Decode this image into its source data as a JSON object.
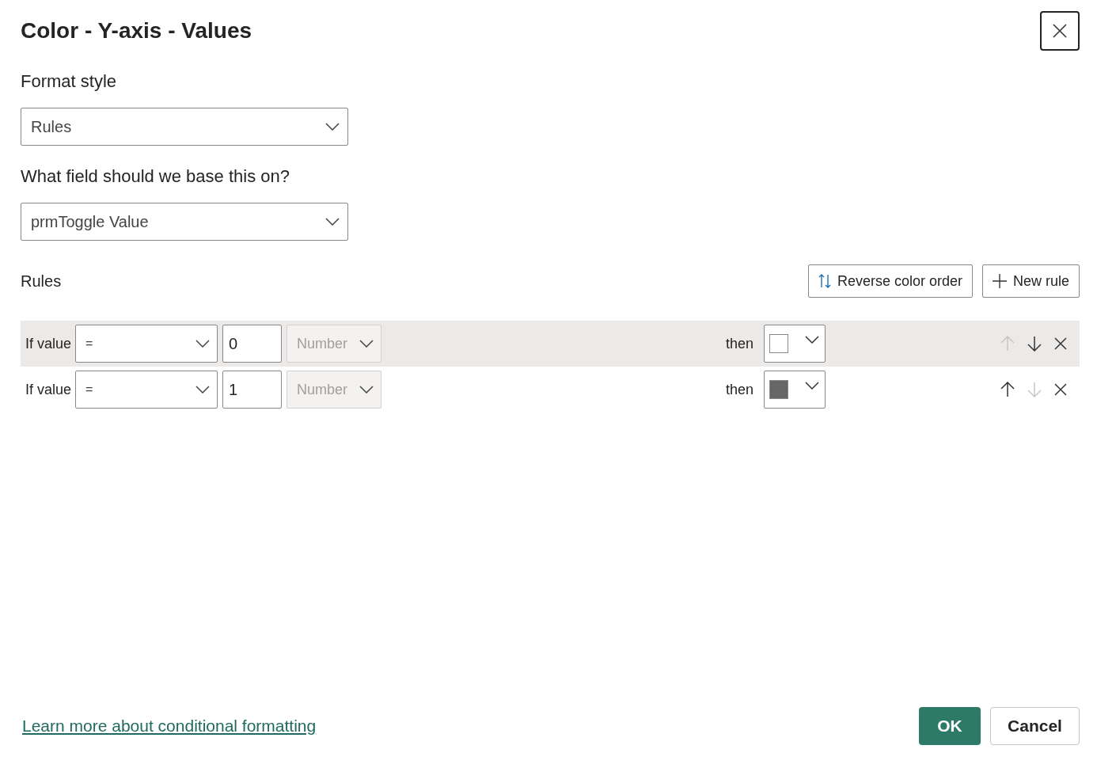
{
  "dialog": {
    "title": "Color - Y-axis - Values"
  },
  "format_style": {
    "label": "Format style",
    "value": "Rules"
  },
  "base_field": {
    "label": "What field should we base this on?",
    "value": "prmToggle Value"
  },
  "rules": {
    "label": "Rules",
    "reverse_button": "Reverse color order",
    "new_rule_button": "New rule",
    "items": [
      {
        "prefix": "If value",
        "operator": "=",
        "value": "0",
        "unit": "Number",
        "unit_disabled": true,
        "then": "then",
        "color": "#ffffff",
        "selected": true,
        "can_move_up": false,
        "can_move_down": true
      },
      {
        "prefix": "If value",
        "operator": "=",
        "value": "1",
        "unit": "Number",
        "unit_disabled": true,
        "then": "then",
        "color": "#666666",
        "selected": false,
        "can_move_up": true,
        "can_move_down": false
      }
    ]
  },
  "footer": {
    "link": "Learn more about conditional formatting",
    "ok": "OK",
    "cancel": "Cancel"
  }
}
